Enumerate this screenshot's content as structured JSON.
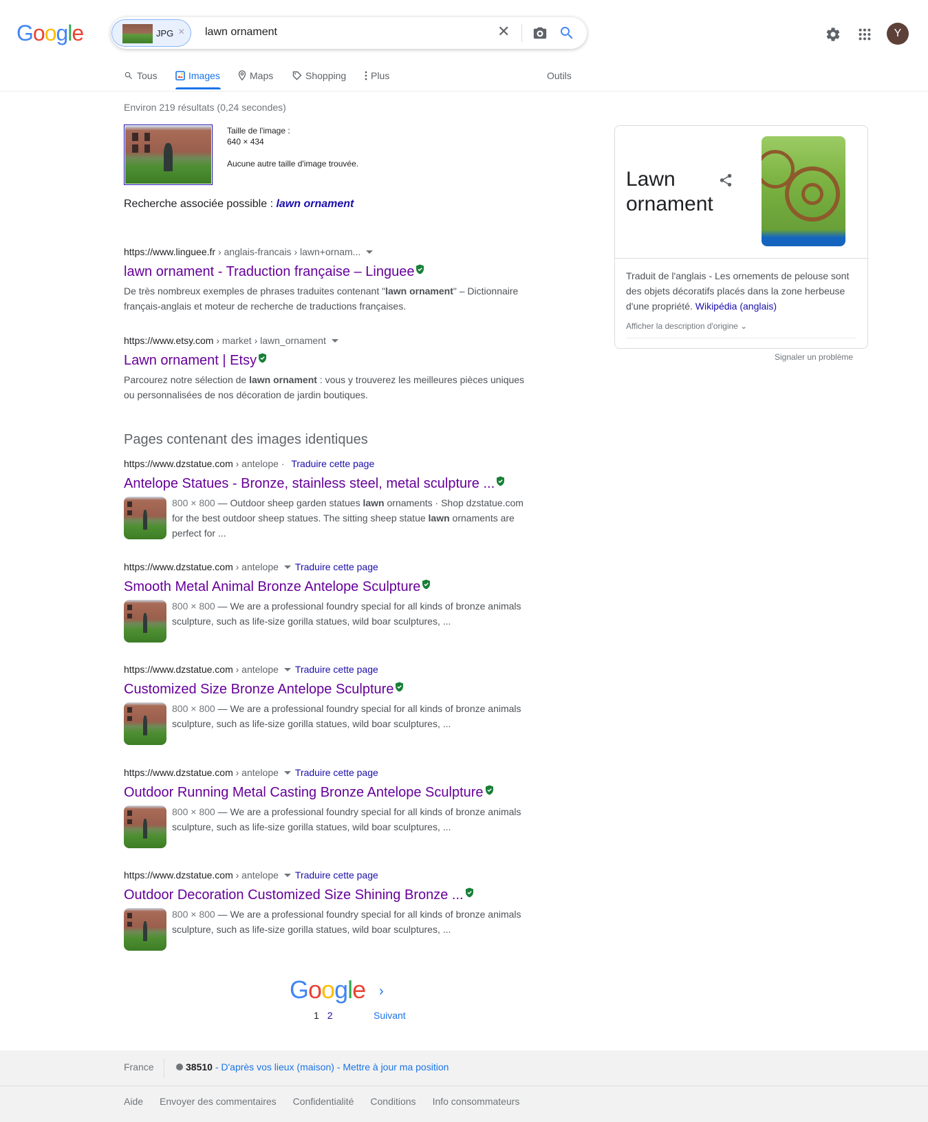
{
  "header": {
    "logo": "Google",
    "chip_label": "JPG",
    "query": "lawn ornament",
    "avatar_letter": "Y"
  },
  "tabs": [
    {
      "label": "Tous",
      "icon": "search-icon"
    },
    {
      "label": "Images",
      "icon": "image-icon",
      "active": true
    },
    {
      "label": "Maps",
      "icon": "map-pin-icon"
    },
    {
      "label": "Shopping",
      "icon": "tag-icon"
    },
    {
      "label": "Plus",
      "icon": "more-vert-icon"
    },
    {
      "label": "Outils"
    }
  ],
  "stats": "Environ 219 résultats (0,24 secondes)",
  "query_image": {
    "size_label": "Taille de l'image :",
    "size_value": "640 × 434",
    "no_other": "Aucune autre taille d'image trouvée."
  },
  "related": {
    "prefix": "Recherche associée possible : ",
    "link": "lawn ornament"
  },
  "web_results": [
    {
      "domain": "https://www.linguee.fr",
      "path": " › anglais-francais › lawn+ornam...",
      "title": "lawn ornament - Traduction française – Linguee",
      "snippet_a": "De très nombreux exemples de phrases traduites contenant \"",
      "snippet_bold": "lawn ornament",
      "snippet_b": "\" – Dictionnaire français-anglais et moteur de recherche de traductions françaises."
    },
    {
      "domain": "https://www.etsy.com",
      "path": " › market › lawn_ornament",
      "title": "Lawn ornament | Etsy",
      "snippet_a": "Parcourez notre sélection de ",
      "snippet_bold": "lawn ornament",
      "snippet_b": " : vous y trouverez les meilleures pièces uniques ou personnalisées de nos décoration de jardin boutiques."
    }
  ],
  "identical_heading": "Pages contenant des images identiques",
  "identical_results": [
    {
      "domain": "https://www.dzstatue.com",
      "path": " › antelope",
      "separator": " · ",
      "translate": "Traduire cette page",
      "title": "Antelope Statues - Bronze, stainless steel, metal sculpture ...",
      "dims": "800 × 800",
      "snip_1": " — Outdoor sheep garden statues ",
      "snip_b1": "lawn",
      "snip_2": " ornaments · Shop dzstatue.com for the best outdoor sheep statues. The sitting sheep statue ",
      "snip_b2": "lawn",
      "snip_3": " ornaments are perfect for ..."
    },
    {
      "domain": "https://www.dzstatue.com",
      "path": " › antelope",
      "translate": "Traduire cette page",
      "title": "Smooth Metal Animal Bronze Antelope Sculpture",
      "dims": "800 × 800",
      "snip_1": " — We are a professional foundry special for all kinds of bronze animals sculpture, such as life-size gorilla statues, wild boar sculptures, ..."
    },
    {
      "domain": "https://www.dzstatue.com",
      "path": " › antelope",
      "translate": "Traduire cette page",
      "title": "Customized Size Bronze Antelope Sculpture",
      "dims": "800 × 800",
      "snip_1": " — We are a professional foundry special for all kinds of bronze animals sculpture, such as life-size gorilla statues, wild boar sculptures, ..."
    },
    {
      "domain": "https://www.dzstatue.com",
      "path": " › antelope",
      "translate": "Traduire cette page",
      "title": "Outdoor Running Metal Casting Bronze Antelope Sculpture",
      "dims": "800 × 800",
      "snip_1": " — We are a professional foundry special for all kinds of bronze animals sculpture, such as life-size gorilla statues, wild boar sculptures, ..."
    },
    {
      "domain": "https://www.dzstatue.com",
      "path": " › antelope",
      "translate": "Traduire cette page",
      "title": "Outdoor Decoration Customized Size Shining Bronze ...",
      "dims": "800 × 800",
      "snip_1": " — We are a professional foundry special for all kinds of bronze animals sculpture, such as life-size gorilla statues, wild boar sculptures, ..."
    }
  ],
  "knowledge_panel": {
    "title": "Lawn ornament",
    "desc": "Traduit de l'anglais - Les ornements de pelouse sont des objets décoratifs placés dans la zone herbeuse d'une propriété. ",
    "wiki_link": "Wikipédia (anglais)",
    "show_original": "Afficher la description d'origine",
    "report": "Signaler un problème"
  },
  "pagination": {
    "logo": "Google",
    "current": "1",
    "next_page": "2",
    "next_label": "Suivant"
  },
  "footer": {
    "country": "France",
    "postal": "38510",
    "loc_text": " - D'après vos lieux (maison)",
    "update_loc": " - Mettre à jour ma position",
    "links": [
      "Aide",
      "Envoyer des commentaires",
      "Confidentialité",
      "Conditions",
      "Info consommateurs"
    ]
  },
  "colors": {
    "link_visited": "#660099",
    "link": "#1a0dab",
    "accent": "#1a73e8",
    "verified": "#188038"
  }
}
